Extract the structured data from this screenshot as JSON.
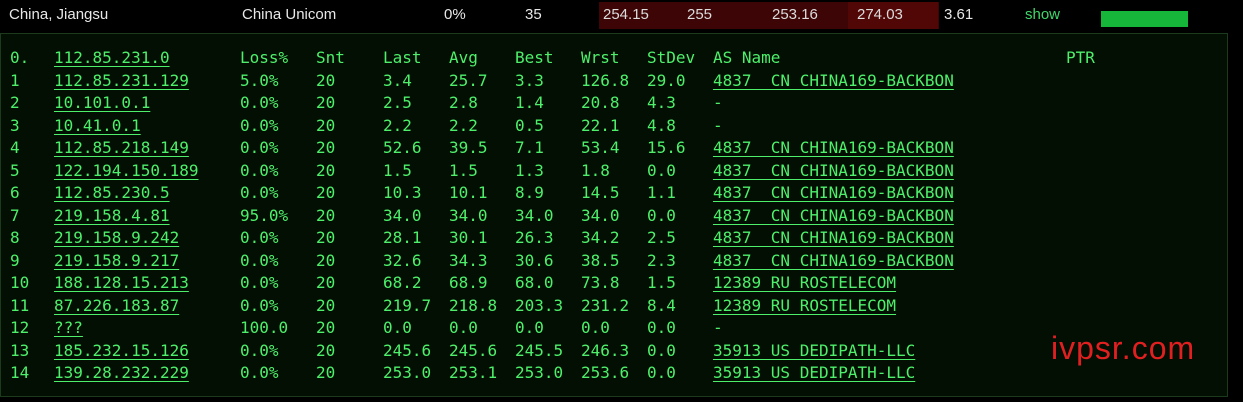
{
  "header": {
    "location": "China, Jiangsu",
    "isp": "China Unicom",
    "loss": "0%",
    "sent": "35",
    "last": "254.15",
    "best": "255",
    "avg": "253.16",
    "worst": "274.03",
    "stdev": "3.61",
    "show_label": "show",
    "accent_color": "#4ef06b"
  },
  "table": {
    "columns": [
      "0.",
      "112.85.231.0",
      "Loss%",
      "Snt",
      "Last",
      "Avg",
      "Best",
      "Wrst",
      "StDev",
      "AS Name",
      "PTR"
    ],
    "rows": [
      {
        "hop": "1",
        "host": "112.85.231.129",
        "loss": "5.0%",
        "snt": "20",
        "last": "3.4",
        "avg": "25.7",
        "best": "3.3",
        "wrst": "126.8",
        "stdev": "29.0",
        "as": "4837  CN CHINA169-BACKBON"
      },
      {
        "hop": "2",
        "host": "10.101.0.1",
        "loss": "0.0%",
        "snt": "20",
        "last": "2.5",
        "avg": "2.8",
        "best": "1.4",
        "wrst": "20.8",
        "stdev": "4.3",
        "as": "-"
      },
      {
        "hop": "3",
        "host": "10.41.0.1",
        "loss": "0.0%",
        "snt": "20",
        "last": "2.2",
        "avg": "2.2",
        "best": "0.5",
        "wrst": "22.1",
        "stdev": "4.8",
        "as": "-"
      },
      {
        "hop": "4",
        "host": "112.85.218.149",
        "loss": "0.0%",
        "snt": "20",
        "last": "52.6",
        "avg": "39.5",
        "best": "7.1",
        "wrst": "53.4",
        "stdev": "15.6",
        "as": "4837  CN CHINA169-BACKBON"
      },
      {
        "hop": "5",
        "host": "122.194.150.189",
        "loss": "0.0%",
        "snt": "20",
        "last": "1.5",
        "avg": "1.5",
        "best": "1.3",
        "wrst": "1.8",
        "stdev": "0.0",
        "as": "4837  CN CHINA169-BACKBON"
      },
      {
        "hop": "6",
        "host": "112.85.230.5",
        "loss": "0.0%",
        "snt": "20",
        "last": "10.3",
        "avg": "10.1",
        "best": "8.9",
        "wrst": "14.5",
        "stdev": "1.1",
        "as": "4837  CN CHINA169-BACKBON"
      },
      {
        "hop": "7",
        "host": "219.158.4.81",
        "loss": "95.0%",
        "snt": "20",
        "last": "34.0",
        "avg": "34.0",
        "best": "34.0",
        "wrst": "34.0",
        "stdev": "0.0",
        "as": "4837  CN CHINA169-BACKBON"
      },
      {
        "hop": "8",
        "host": "219.158.9.242",
        "loss": "0.0%",
        "snt": "20",
        "last": "28.1",
        "avg": "30.1",
        "best": "26.3",
        "wrst": "34.2",
        "stdev": "2.5",
        "as": "4837  CN CHINA169-BACKBON"
      },
      {
        "hop": "9",
        "host": "219.158.9.217",
        "loss": "0.0%",
        "snt": "20",
        "last": "32.6",
        "avg": "34.3",
        "best": "30.6",
        "wrst": "38.5",
        "stdev": "2.3",
        "as": "4837  CN CHINA169-BACKBON"
      },
      {
        "hop": "10",
        "host": "188.128.15.213",
        "loss": "0.0%",
        "snt": "20",
        "last": "68.2",
        "avg": "68.9",
        "best": "68.0",
        "wrst": "73.8",
        "stdev": "1.5",
        "as": "12389 RU ROSTELECOM"
      },
      {
        "hop": "11",
        "host": "87.226.183.87",
        "loss": "0.0%",
        "snt": "20",
        "last": "219.7",
        "avg": "218.8",
        "best": "203.3",
        "wrst": "231.2",
        "stdev": "8.4",
        "as": "12389 RU ROSTELECOM"
      },
      {
        "hop": "12",
        "host": "???",
        "loss": "100.0",
        "snt": "20",
        "last": "0.0",
        "avg": "0.0",
        "best": "0.0",
        "wrst": "0.0",
        "stdev": "0.0",
        "as": "-"
      },
      {
        "hop": "13",
        "host": "185.232.15.126",
        "loss": "0.0%",
        "snt": "20",
        "last": "245.6",
        "avg": "245.6",
        "best": "245.5",
        "wrst": "246.3",
        "stdev": "0.0",
        "as": "35913 US DEDIPATH-LLC"
      },
      {
        "hop": "14",
        "host": "139.28.232.229",
        "loss": "0.0%",
        "snt": "20",
        "last": "253.0",
        "avg": "253.1",
        "best": "253.0",
        "wrst": "253.6",
        "stdev": "0.0",
        "as": "35913 US DEDIPATH-LLC"
      }
    ]
  },
  "watermark": "ivpsr.com"
}
